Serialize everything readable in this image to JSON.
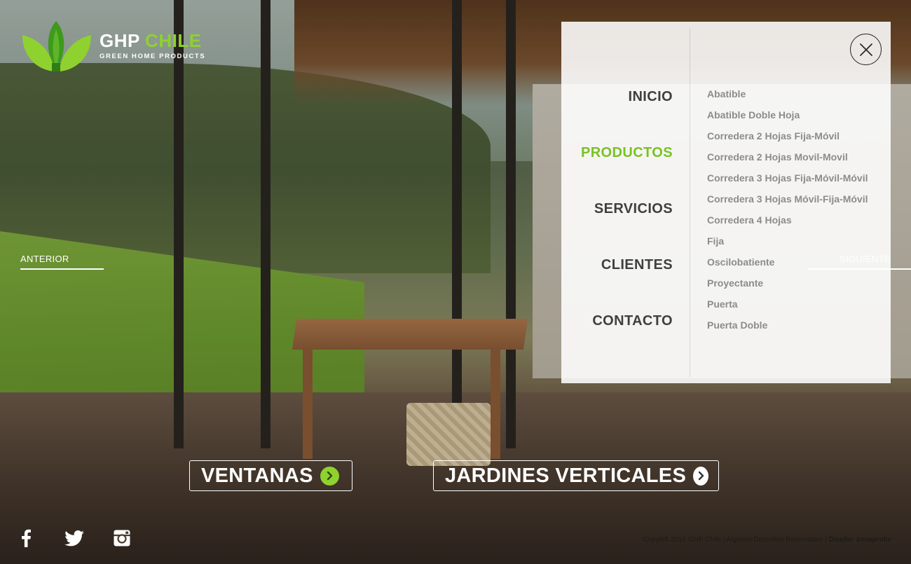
{
  "logo": {
    "name_main": "GHP",
    "name_accent": "CHILE",
    "tagline": "GREEN HOME PRODUCTS",
    "icon": "leaf-logo-icon",
    "colors": {
      "leaf_dark": "#3e9a1c",
      "leaf_light": "#8fd12f"
    }
  },
  "slider": {
    "prev_label": "ANTERIOR",
    "next_label": "SIGUIENTE"
  },
  "cta": [
    {
      "label": "VENTANAS",
      "arrow_color": "#8fd12f",
      "icon": "arrow-right-circle-icon"
    },
    {
      "label": "JARDINES VERTICALES",
      "arrow_color": "#ffffff",
      "icon": "arrow-right-circle-icon"
    }
  ],
  "menu": {
    "items": [
      {
        "label": "INICIO",
        "active": false
      },
      {
        "label": "PRODUCTOS",
        "active": true
      },
      {
        "label": "SERVICIOS",
        "active": false
      },
      {
        "label": "CLIENTES",
        "active": false
      },
      {
        "label": "CONTACTO",
        "active": false
      }
    ],
    "submenu": [
      "Abatible",
      "Abatible Doble Hoja",
      "Corredera 2 Hojas Fija-Móvil",
      "Corredera 2 Hojas Movil-Movil",
      "Corredera 3 Hojas Fija-Móvil-Móvil",
      "Corredera 3 Hojas Móvil-Fija-Móvil",
      "Corredera 4 Hojas",
      "Fija",
      "Oscilobatiente",
      "Proyectante",
      "Puerta",
      "Puerta Doble"
    ],
    "close_icon": "close-icon",
    "accent_color": "#79c323"
  },
  "social": [
    {
      "name": "facebook",
      "icon": "facebook-icon"
    },
    {
      "name": "twitter",
      "icon": "twitter-icon"
    },
    {
      "name": "instagram",
      "icon": "instagram-icon"
    }
  ],
  "footer": {
    "copyright": "Copyleft 2016  GHP Chile | Algunos Derechos Reservados |",
    "design_label": "Diseño:",
    "design_by": "zonaprolix"
  }
}
